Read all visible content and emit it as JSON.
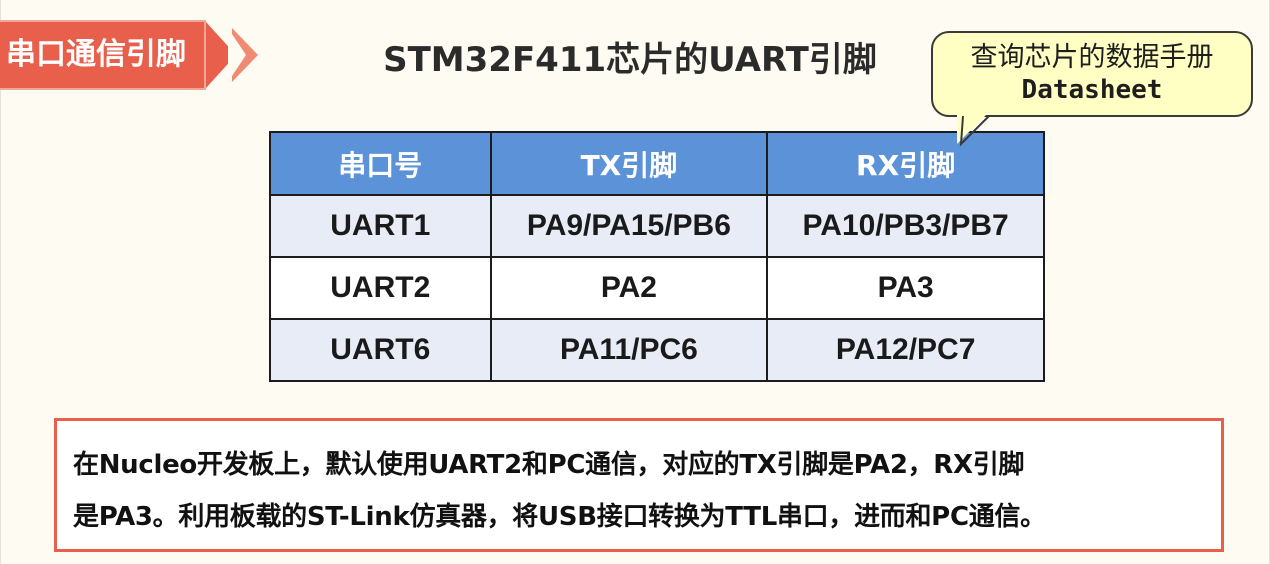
{
  "section_tag": {
    "label": "串口通信引脚"
  },
  "title": "STM32F411芯片的UART引脚",
  "callout": {
    "line1": "查询芯片的数据手册",
    "line2": "Datasheet"
  },
  "table": {
    "headers": [
      "串口号",
      "TX引脚",
      "RX引脚"
    ],
    "rows": [
      [
        "UART1",
        "PA9/PA15/PB6",
        "PA10/PB3/PB7"
      ],
      [
        "UART2",
        "PA2",
        "PA3"
      ],
      [
        "UART6",
        "PA11/PC6",
        "PA12/PC7"
      ]
    ]
  },
  "note": {
    "line1": "在Nucleo开发板上，默认使用UART2和PC通信，对应的TX引脚是PA2，RX引脚",
    "line2": "是PA3。利用板载的ST-Link仿真器，将USB接口转换为TTL串口，进而和PC通信。"
  },
  "colors": {
    "accent": "#e8604c",
    "table_header": "#5b92d8",
    "row_alt": "#e8ecf7",
    "callout_bg": "#ffffc4",
    "background": "#fdfbf2"
  }
}
